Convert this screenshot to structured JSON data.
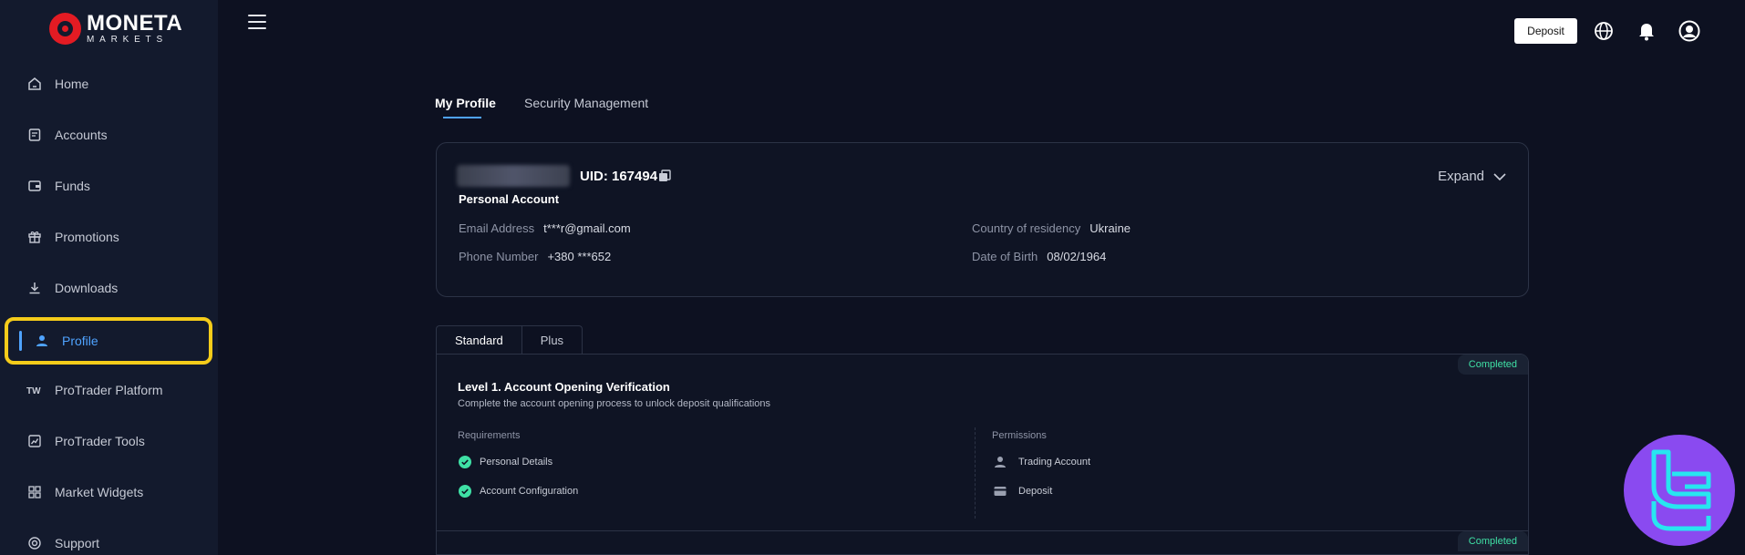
{
  "brand": {
    "name": "MONETA",
    "sub": "MARKETS"
  },
  "sidebar": {
    "items": [
      {
        "label": "Home",
        "icon": "home-icon"
      },
      {
        "label": "Accounts",
        "icon": "accounts-icon"
      },
      {
        "label": "Funds",
        "icon": "wallet-icon"
      },
      {
        "label": "Promotions",
        "icon": "gift-icon"
      },
      {
        "label": "Downloads",
        "icon": "download-icon"
      },
      {
        "label": "Profile",
        "icon": "user-icon",
        "active": true
      },
      {
        "label": "ProTrader Platform",
        "icon": "protrader-icon"
      },
      {
        "label": "ProTrader Tools",
        "icon": "chart-icon"
      },
      {
        "label": "Market Widgets",
        "icon": "widgets-icon"
      },
      {
        "label": "Support",
        "icon": "support-icon"
      }
    ]
  },
  "header": {
    "deposit_label": "Deposit"
  },
  "tabs": {
    "profile": "My Profile",
    "security": "Security Management"
  },
  "profile": {
    "uid": "UID: 167494",
    "account_type": "Personal Account",
    "expand_label": "Expand",
    "email_label": "Email Address",
    "email_value": "t***r@gmail.com",
    "phone_label": "Phone Number",
    "phone_value": "+380 ***652",
    "country_label": "Country of residency",
    "country_value": "Ukraine",
    "dob_label": "Date of Birth",
    "dob_value": "08/02/1964"
  },
  "verification": {
    "tabs": [
      "Standard",
      "Plus"
    ],
    "levels": [
      {
        "status": "Completed",
        "title": "Level 1. Account Opening Verification",
        "description": "Complete the account opening process to unlock deposit qualifications",
        "requirements_label": "Requirements",
        "requirements": [
          "Personal Details",
          "Account Configuration"
        ],
        "permissions_label": "Permissions",
        "permissions": [
          "Trading Account",
          "Deposit"
        ]
      },
      {
        "status": "Completed"
      }
    ]
  },
  "colors": {
    "accent": "#4fa3ff",
    "completed": "#3fe0a5",
    "highlight": "#f5cc1a",
    "background": "#0d1121",
    "sidebar": "#131a2d"
  }
}
